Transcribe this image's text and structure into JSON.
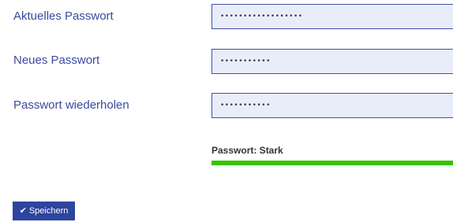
{
  "form": {
    "current_password": {
      "label": "Aktuelles Passwort",
      "value": "••••••••••••••••••"
    },
    "new_password": {
      "label": "Neues Passwort",
      "value": "•••••••••••"
    },
    "repeat_password": {
      "label": "Passwort wiederholen",
      "value": "•••••••••••"
    }
  },
  "strength": {
    "text": "Passwort: Stark",
    "level_percent": 100,
    "color": "#36c400"
  },
  "actions": {
    "save_icon": "check-icon",
    "save_label": "Speichern"
  }
}
